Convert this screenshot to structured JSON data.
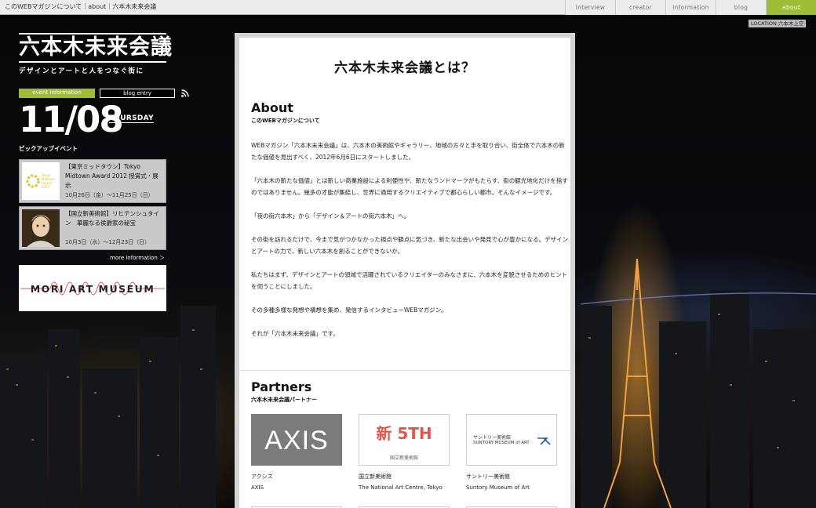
{
  "topbar": {
    "breadcrumb": "このWEBマガジンについて｜about｜六本木未来会議",
    "nav": [
      {
        "label": "interview",
        "active": false
      },
      {
        "label": "creator",
        "active": false
      },
      {
        "label": "information",
        "active": false
      },
      {
        "label": "blog",
        "active": false
      },
      {
        "label": "about",
        "active": true
      }
    ],
    "location": "LOCATION 六本木上空"
  },
  "sidebar": {
    "logo_title": "六本木未来会議",
    "tagline": "デザインとアートと人をつなぐ街に",
    "tab_event": "event information",
    "tab_blog": "blog entry",
    "date": "11/08",
    "weekday": "THURSDAY",
    "pickup_label": "ピックアップイベント",
    "events": [
      {
        "title": "【東京ミッドタウン】Tokyo Midtown Award 2012 授賞式・展示",
        "dates": "10月26日（金）～11月25日（日）",
        "thumb_text": "Tokyo Midtown Award 2012"
      },
      {
        "title": "【国立新美術館】リヒテンシュタイン　華麗なる侯爵家の秘宝",
        "dates": "10月3日（水）～12月23日（日）"
      }
    ],
    "more_info": "more information ＞",
    "banner": "MORI ART MUSEUM"
  },
  "main": {
    "title": "六本木未来会議とは？",
    "about_heading": "About",
    "about_sub": "このWEBマガジンについて",
    "paragraphs": [
      "WEBマガジン「六本木未来会議」は、六本木の美術館やギャラリー、地域の方々と手を取り合い、街全体で六本木の新たな価値を見出すべく、2012年6月6日にスタートしました。",
      "「六本木の新たな価値」とは新しい商業施設による利便性や、新たなランドマークがもたらす、街の観光地化だけを指すのではありません。幾多の才能が集結し、世界に通用するクリエイティブで都心らしい都市。そんなイメージです。",
      "「夜の街六本木」から「デザイン＆アートの街六本木」へ。",
      "その街を訪れるだけで、今まで気がつかなかった視点や観点に気づき、新たな出会いや発見で心が豊かになる。デザインとアートの力で、新しい六本木を創ることができないか。",
      "私たちはまず、デザインとアートの領域で活躍されているクリエイターのみなさまに、六本木を変貌させるためのヒントを伺うことにしました。",
      "その多種多様な発想や構想を集め、発信するインタビューWEBマガジン。",
      "それが「六本木未来会議」です。"
    ],
    "partners_heading": "Partners",
    "partners_sub": "六本木未来会議パートナー",
    "partners": [
      {
        "logo_text": "AXIS",
        "name_ja": "アクシス",
        "name_en": "AXIS"
      },
      {
        "logo_text": "新 5TH",
        "logo_caption": "国立新美術館",
        "name_ja": "国立新美術館",
        "name_en": "The National Art Centre, Tokyo"
      },
      {
        "logo_text": "サントリー美術館",
        "logo_caption": "SUNTORY MUSEUM of ART",
        "name_ja": "サントリー美術館",
        "name_en": "Suntory Museum of Art"
      }
    ]
  },
  "colors": {
    "accent_green": "#9ebc35",
    "panel_border": "#d4d4d4"
  }
}
